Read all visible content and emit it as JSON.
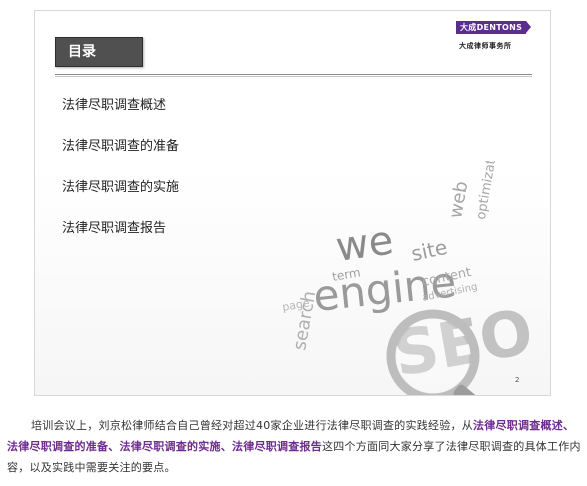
{
  "slide": {
    "title": "目录",
    "logo_text": "大成DENTONS",
    "logo_subtitle": "大成律师事务所",
    "agenda": [
      "法律尽职调查概述",
      "法律尽职调查的准备",
      "法律尽职调查的实施",
      "法律尽职调查报告"
    ],
    "art_words": [
      "we",
      "engine",
      "site",
      "content",
      "search",
      "SEO",
      "term",
      "page",
      "web",
      "advertising",
      "optimization"
    ],
    "page_number": "2"
  },
  "caption": {
    "intro": "培训会议上，刘京松律师结合自己曾经对超过40家企业进行法律尽职调查的实践经验，从",
    "topic1": "法律尽职调查概述",
    "sep1": "、",
    "topic2": "法律尽职调查的准备",
    "sep2": "、",
    "topic3": "法律尽职调查的实施",
    "sep3": "、",
    "topic4": "法律尽职调查报告",
    "outro": "这四个方面同大家分享了法律尽职调查的具体工作内容，以及实践中需要关注的要点。"
  },
  "colors": {
    "highlight": "#6f2b8e",
    "logo": "#5c2d91",
    "title_box": "#505050"
  }
}
